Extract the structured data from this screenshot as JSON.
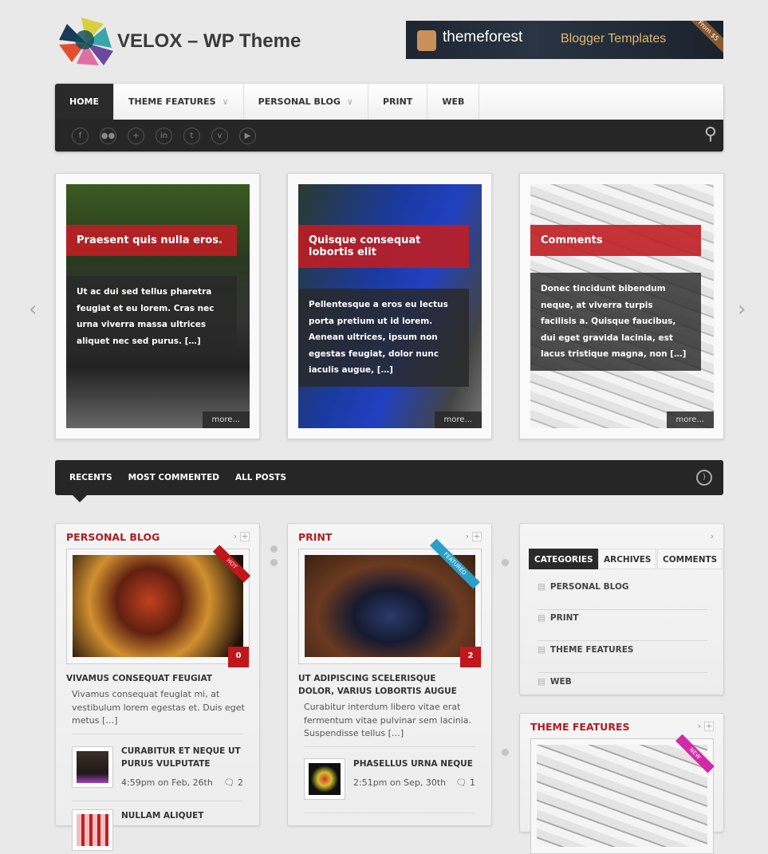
{
  "header": {
    "site_title": "VELOX – WP Theme",
    "banner": {
      "brand": "themeforest",
      "tagline": "Blogger Templates",
      "badge": "From $5"
    }
  },
  "nav": {
    "items": [
      {
        "label": "HOME",
        "active": true
      },
      {
        "label": "THEME FEATURES",
        "dropdown": true
      },
      {
        "label": "PERSONAL BLOG",
        "dropdown": true
      },
      {
        "label": "PRINT"
      },
      {
        "label": "WEB"
      }
    ],
    "social": [
      "facebook-icon",
      "flickr-icon",
      "google-icon",
      "linkedin-icon",
      "twitter-icon",
      "vimeo-icon",
      "youtube-icon"
    ],
    "social_glyphs": [
      "f",
      "●●",
      "+",
      "in",
      "t",
      "v",
      "▶"
    ]
  },
  "slider": {
    "slides": [
      {
        "title": "Praesent quis nulla eros.",
        "excerpt": "Ut ac dui sed tellus pharetra feugiat et eu lorem. Cras nec urna viverra massa ultrices aliquet nec sed purus. […]",
        "more": "more..."
      },
      {
        "title": "Quisque consequat lobortis elit",
        "excerpt": "Pellentesque a eros eu lectus porta pretium ut id lorem. Aenean ultrices, ipsum non egestas feugiat, dolor nunc iaculis augue, […]",
        "more": "more..."
      },
      {
        "title": "Comments",
        "excerpt": "Donec tincidunt bibendum neque, at viverra turpis facilisis a. Quisque faucibus, dui eget gravida lacinia, est lacus tristique magna, non […]",
        "more": "more..."
      }
    ]
  },
  "tabs": [
    "RECENTS",
    "MOST COMMENTED",
    "ALL POSTS"
  ],
  "widgets": {
    "personal_blog": {
      "title": "PERSONAL BLOG",
      "ribbon": "HOT",
      "ribbon_color": "#c0171c",
      "comments": "0",
      "post_title": "VIVAMUS CONSEQUAT FEUGIAT",
      "excerpt": "Vivamus consequat feugiat mi, at vestibulum lorem egestas et. Duis eget metus […]",
      "list": [
        {
          "title": "CURABITUR ET NEQUE UT PURUS VULPUTATE",
          "date": "4:59pm on Feb, 26th",
          "comments": "2"
        },
        {
          "title": "NULLAM ALIQUET"
        }
      ]
    },
    "print": {
      "title": "PRINT",
      "ribbon": "FEATURED",
      "ribbon_color": "#2aa0c8",
      "comments": "2",
      "post_title": "UT ADIPISCING SCELERISQUE DOLOR, VARIUS LOBORTIS AUGUE",
      "excerpt": "Curabitur interdum libero vitae erat fermentum vitae pulvinar sem lacinia. Suspendisse tellus […]",
      "list": [
        {
          "title": "PHASELLUS URNA NEQUE",
          "date": "2:51pm on Sep, 30th",
          "comments": "1"
        }
      ]
    },
    "categories": {
      "tabs": [
        "CATEGORIES",
        "ARCHIVES",
        "COMMENTS"
      ],
      "items": [
        "PERSONAL BLOG",
        "PRINT",
        "THEME FEATURES",
        "WEB"
      ]
    },
    "theme_features": {
      "title": "THEME FEATURES",
      "ribbon": "NEW",
      "ribbon_color": "#d02aa8"
    }
  },
  "colors": {
    "accent": "#b01c22",
    "dark": "#262626",
    "background": "#e9e9e9"
  }
}
